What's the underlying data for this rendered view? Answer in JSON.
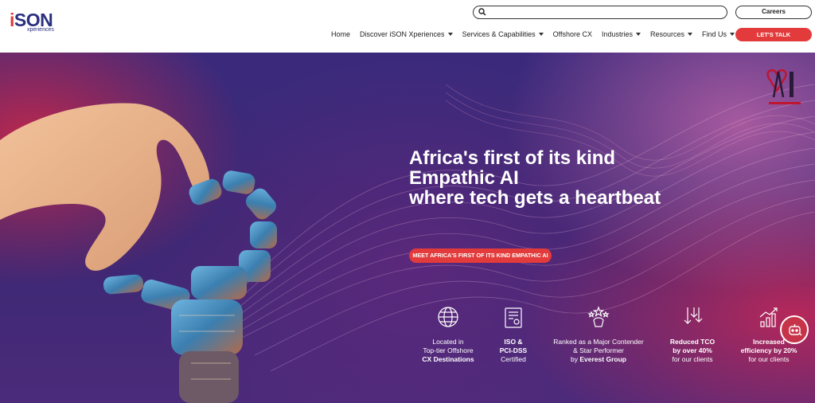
{
  "brand": {
    "logo_main": "SON",
    "logo_i": "i",
    "logo_sub": "xperiences"
  },
  "search": {
    "placeholder": ""
  },
  "header": {
    "careers_label": "Careers",
    "cta_label": "LET'S TALK",
    "nav": [
      {
        "label": "Home",
        "has_caret": false
      },
      {
        "label": "Discover iSON Xperiences",
        "has_caret": true
      },
      {
        "label": "Services & Capabilities",
        "has_caret": true
      },
      {
        "label": "Offshore CX",
        "has_caret": false
      },
      {
        "label": "Industries",
        "has_caret": true
      },
      {
        "label": "Resources",
        "has_caret": true
      },
      {
        "label": "Find Us",
        "has_caret": true
      }
    ]
  },
  "hero": {
    "headline_1": "Africa's first of its kind",
    "headline_2": "Empathic AI",
    "headline_3": "where tech gets a heartbeat",
    "cta_label": "MEET AFRICA'S FIRST OF ITS KIND EMPATHIC AI",
    "ai_logo_text": "AI"
  },
  "features": [
    {
      "icon": "globe-icon",
      "line1": "Located in",
      "line2": "Top-tier Offshore",
      "line3": "CX Destinations"
    },
    {
      "icon": "certificate-icon",
      "line1": "ISO &",
      "line2": "PCI-DSS",
      "line3": "Certified"
    },
    {
      "icon": "award-stars-icon",
      "line1": "Ranked as a Major Contender",
      "line2": "& Star Performer",
      "line3_prefix": "by ",
      "line3": "Everest Group"
    },
    {
      "icon": "down-arrows-icon",
      "line1": "Reduced TCO",
      "line2": "by over 40%",
      "line3": "for our clients"
    },
    {
      "icon": "growth-chart-icon",
      "line1": "Increased",
      "line2": "efficiency by 20%",
      "line3": "for our clients"
    }
  ],
  "colors": {
    "accent": "#e33b3b",
    "brand_navy": "#2a2f80",
    "hero_purple": "#3b2a7c"
  }
}
